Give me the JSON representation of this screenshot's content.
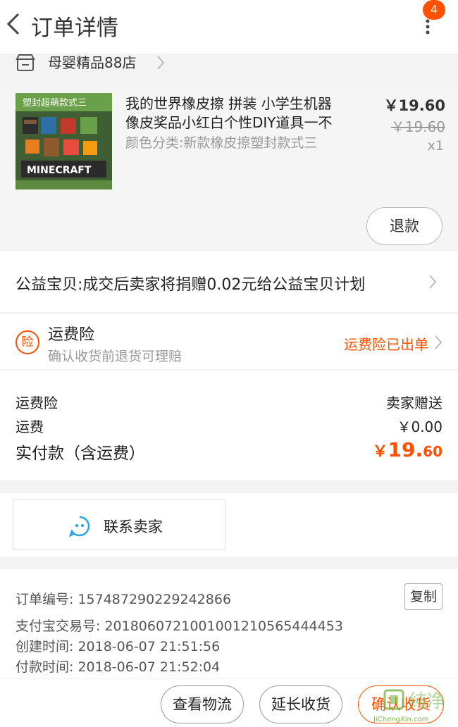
{
  "header": {
    "title": "订单详情",
    "badge_count": "4"
  },
  "shop": {
    "name": "母婴精品88店"
  },
  "product": {
    "title_line1": "我的世界橡皮擦 拼装 小学生机器",
    "title_line2": "像皮奖品小红白个性DIY道具一不",
    "variant": "颜色分类:新款橡皮擦塑封款式三",
    "price": "￥19.60",
    "original_price": "￥19.60",
    "quantity": "x1",
    "refund_label": "退款",
    "thumb_caption_top": "塑封超萌款式三",
    "thumb_caption_bottom": "MINECRAFT"
  },
  "charity": {
    "text": "公益宝贝:成交后卖家将捐赠0.02元给公益宝贝计划"
  },
  "insurance": {
    "icon_text": "险",
    "title": "运费险",
    "subtitle": "确认收货前退货可理赔",
    "status": "运费险已出单"
  },
  "totals": {
    "insurance_label": "运费险",
    "insurance_value": "卖家赠送",
    "shipping_label": "运费",
    "shipping_value": "￥0.00",
    "paid_label": "实付款（含运费）",
    "paid_currency": "￥",
    "paid_int": "19.",
    "paid_dec": "60"
  },
  "contact": {
    "label": "联系卖家"
  },
  "order_info": {
    "order_no": "订单编号: 157487290229242866",
    "copy_label": "复制",
    "alipay_no": "支付宝交易号: 2018060721001001210565444453",
    "created": "创建时间: 2018-06-07 21:51:56",
    "paid": "付款时间: 2018-06-07 21:52:04"
  },
  "actions": {
    "logistics": "查看物流",
    "extend": "延长收货",
    "confirm": "确认收货"
  },
  "watermark": {
    "text": "纯净",
    "sub": "JiChengXin.com"
  },
  "colors": {
    "accent": "#ff5000",
    "background": "#f3f3f3"
  }
}
